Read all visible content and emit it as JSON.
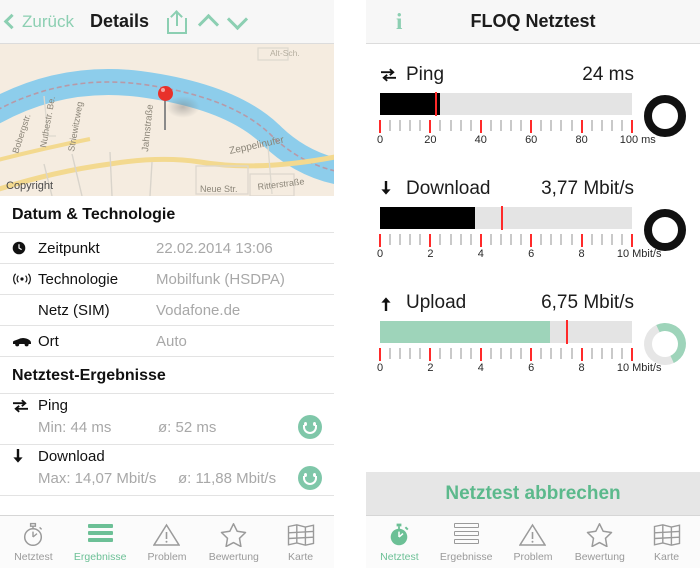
{
  "left_panel": {
    "navbar": {
      "back_label": "Zurück",
      "title": "Details",
      "share_icon": "share-icon",
      "up_icon": "chevron-up-icon",
      "down_icon": "chevron-down-icon"
    },
    "map": {
      "copyright": "Copyright",
      "streets": [
        "Zeppelinufer",
        "Jahnstraße",
        "Strewitzweg",
        "Nuthestraße",
        "Neue Str.",
        "Ritterstraße",
        "Boberstraße",
        "Alt-Sch."
      ],
      "pin": "location-pin"
    },
    "sections": [
      {
        "heading": "Datum & Technologie",
        "rows": [
          {
            "icon": "clock-icon",
            "label": "Zeitpunkt",
            "value": "22.02.2014 13:06"
          },
          {
            "icon": "signal-icon",
            "label": "Technologie",
            "value": "Mobilfunk (HSDPA)"
          },
          {
            "icon": "",
            "label": "Netz (SIM)",
            "value": "Vodafone.de"
          },
          {
            "icon": "car-icon",
            "label": "Ort",
            "value": "Auto"
          }
        ]
      }
    ],
    "results": {
      "heading": "Netztest-Ergebnisse",
      "items": [
        {
          "icon": "ping-icon",
          "name": "Ping",
          "min": "Min: 44 ms",
          "avg": "ø: 52 ms",
          "rating": "smiley-happy"
        },
        {
          "icon": "download-icon",
          "name": "Download",
          "min": "Max: 14,07 Mbit/s",
          "avg": "ø: 11,88 Mbit/s",
          "rating": "smiley-happy"
        }
      ]
    },
    "tabs": [
      {
        "label": "Netztest",
        "icon": "stopwatch-icon",
        "active": false
      },
      {
        "label": "Ergebnisse",
        "icon": "list-bars-icon",
        "active": true
      },
      {
        "label": "Problem",
        "icon": "warning-triangle-icon",
        "active": false
      },
      {
        "label": "Bewertung",
        "icon": "star-icon",
        "active": false
      },
      {
        "label": "Karte",
        "icon": "map-grid-icon",
        "active": false
      }
    ]
  },
  "right_panel": {
    "navbar": {
      "info_icon": "info-icon",
      "title": "FLOQ Netztest"
    },
    "cancel_button": "Netztest abbrechen",
    "tabs": [
      {
        "label": "Netztest",
        "icon": "stopwatch-icon",
        "active": true
      },
      {
        "label": "Ergebnisse",
        "icon": "list-bars-icon",
        "active": false
      },
      {
        "label": "Problem",
        "icon": "warning-triangle-icon",
        "active": false
      },
      {
        "label": "Bewertung",
        "icon": "star-icon",
        "active": false
      },
      {
        "label": "Karte",
        "icon": "map-grid-icon",
        "active": false
      }
    ]
  },
  "chart_data": [
    {
      "type": "bar",
      "title": "Ping",
      "icon": "ping-icon",
      "value_label": "24 ms",
      "value": 24,
      "unit": "ms",
      "fill_percent": 24,
      "marker_percent": 22,
      "fill_color": "#000000",
      "marker_color": "#ff2a2a",
      "track_color": "#e4e4e4",
      "state": "complete",
      "ring": "complete-black-ring",
      "axis": {
        "min": 0,
        "max": 100,
        "major_step": 20,
        "minor_step": 4,
        "ticklabels": [
          "0",
          "20",
          "40",
          "60",
          "80",
          "100 ms"
        ],
        "tickvalues": [
          0,
          20,
          40,
          60,
          80,
          100
        ]
      }
    },
    {
      "type": "bar",
      "title": "Download",
      "icon": "download-icon",
      "value_label": "3,77 Mbit/s",
      "value": 3.77,
      "unit": "Mbit/s",
      "fill_percent": 37.7,
      "marker_percent": 48,
      "fill_color": "#000000",
      "marker_color": "#ff2a2a",
      "track_color": "#e4e4e4",
      "state": "complete",
      "ring": "complete-black-ring",
      "axis": {
        "min": 0,
        "max": 10,
        "major_step": 2,
        "minor_step": 0.4,
        "ticklabels": [
          "0",
          "2",
          "4",
          "6",
          "8",
          "10 Mbit/s"
        ],
        "tickvalues": [
          0,
          2,
          4,
          6,
          8,
          10
        ]
      }
    },
    {
      "type": "bar",
      "title": "Upload",
      "icon": "upload-icon",
      "value_label": "6,75 Mbit/s",
      "value": 6.75,
      "unit": "Mbit/s",
      "fill_percent": 67.5,
      "marker_percent": 74,
      "fill_color": "#9ed4ba",
      "marker_color": "#ff2a2a",
      "track_color": "#e4e4e4",
      "state": "running",
      "ring": "partial-green-ring",
      "axis": {
        "min": 0,
        "max": 10,
        "major_step": 2,
        "minor_step": 0.4,
        "ticklabels": [
          "0",
          "2",
          "4",
          "6",
          "8",
          "10 Mbit/s"
        ],
        "tickvalues": [
          0,
          2,
          4,
          6,
          8,
          10
        ]
      }
    }
  ],
  "colors": {
    "accent_green": "#6cc096",
    "light_green": "#8ccfb2",
    "bar_green": "#9ed4ba",
    "marker_red": "#ff2a2a",
    "track_gray": "#e4e4e4",
    "muted_text": "#a8a8a8"
  }
}
